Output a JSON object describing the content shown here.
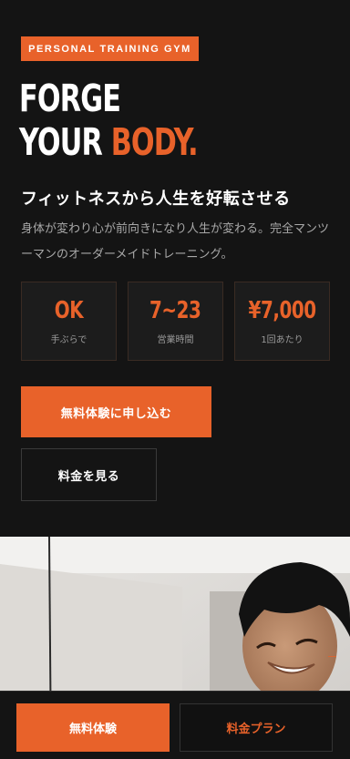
{
  "hero": {
    "badge": "PERSONAL TRAINING GYM",
    "headline_line1": "FORGE",
    "headline_line2_white": "YOUR ",
    "headline_line2_accent": "BODY.",
    "subhead": "フィットネスから人生を好転させる",
    "description": "身体が変わり心が前向きになり人生が変わる。完全マンツーマンのオーダーメイドトレーニング。"
  },
  "stats": [
    {
      "value": "OK",
      "label": "手ぶらで"
    },
    {
      "value": "7~23",
      "label": "営業時間"
    },
    {
      "value": "¥7,000",
      "label": "1回あたり"
    }
  ],
  "cta": {
    "primary": "無料体験に申し込む",
    "secondary": "料金を見る"
  },
  "bottom_bar": {
    "primary": "無料体験",
    "secondary": "料金プラン"
  },
  "colors": {
    "accent": "#e8622a",
    "background": "#141414",
    "text": "#ffffff",
    "muted": "#a8a8a8"
  }
}
